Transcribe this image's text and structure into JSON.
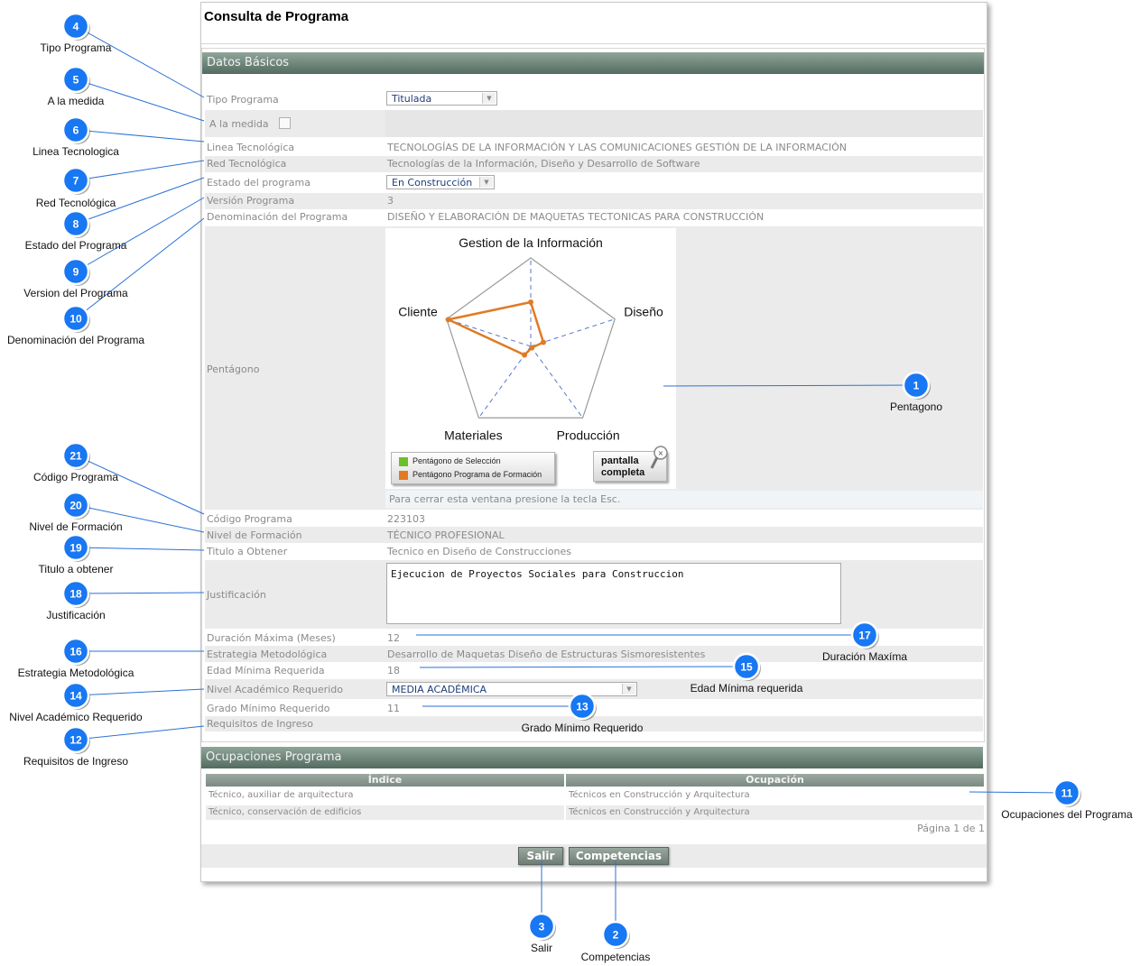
{
  "page_title": "Consulta de Programa",
  "sections": {
    "basic": "Datos Básicos",
    "occupations": "Ocupaciones Programa"
  },
  "fields": {
    "tipo_programa": {
      "label": "Tipo Programa",
      "value": "Titulada"
    },
    "a_la_medida": {
      "label": "A la medida",
      "checked": false
    },
    "linea_tecnologica": {
      "label": "Linea Tecnológica",
      "value": "TECNOLOGÍAS DE LA INFORMACIÓN Y LAS COMUNICACIONES GESTIÓN DE LA INFORMACIÓN"
    },
    "red_tecnologica": {
      "label": "Red Tecnológica",
      "value": "Tecnologías de la Información, Diseño y Desarrollo de Software"
    },
    "estado_programa": {
      "label": "Estado del programa",
      "value": "En Construcción"
    },
    "version_programa": {
      "label": "Versión Programa",
      "value": "3"
    },
    "denominacion": {
      "label": "Denominación del Programa",
      "value": "DISEÑO Y ELABORACIÓN DE MAQUETAS TECTONICAS PARA CONSTRUCCIÓN"
    },
    "pentagono": {
      "label": "Pentágono",
      "note": "Para cerrar esta ventana presione la tecla Esc."
    },
    "codigo_programa": {
      "label": "Código Programa",
      "value": "223103"
    },
    "nivel_formacion": {
      "label": "Nivel de Formación",
      "value": "TÉCNICO PROFESIONAL"
    },
    "titulo_obtener": {
      "label": "Titulo a Obtener",
      "value": "Tecnico en Diseño de Construcciones"
    },
    "justificacion": {
      "label": "Justificación",
      "value": "Ejecucion de Proyectos Sociales para Construccion"
    },
    "duracion_maxima": {
      "label": "Duración Máxima (Meses)",
      "value": "12"
    },
    "estrategia": {
      "label": "Estrategia Metodológica",
      "value": "Desarrollo de Maquetas Diseño de Estructuras Sismoresistentes"
    },
    "edad_minima": {
      "label": "Edad Mínima Requerida",
      "value": "18"
    },
    "nivel_academico": {
      "label": "Nivel Académico Requerido",
      "value": "MEDIA ACADÉMICA"
    },
    "grado_minimo": {
      "label": "Grado Mínimo Requerido",
      "value": "11"
    },
    "requisitos": {
      "label": "Requisitos de Ingreso",
      "value": ""
    }
  },
  "chart_data": {
    "type": "radar",
    "axes": [
      "Gestion de la Información",
      "Diseño",
      "Producción",
      "Materiales",
      "Cliente"
    ],
    "series": [
      {
        "name": "Pentágono de Selección",
        "color": "#6abf2a",
        "values": []
      },
      {
        "name": "Pentágono Programa de Formación",
        "color": "#e07b24",
        "values": [
          0.5,
          0.15,
          0.02,
          0.12,
          0.98
        ]
      }
    ],
    "range": [
      0,
      1
    ]
  },
  "pentagon_ui": {
    "legend_selection": "Pentágono de Selección",
    "legend_program": "Pentágono Programa de Formación",
    "full_screen_line1": "pantalla",
    "full_screen_line2": "completa"
  },
  "occupations_table": {
    "headers": [
      "Índice",
      "Ocupación"
    ],
    "rows": [
      [
        "Técnico, auxiliar de arquitectura",
        "Técnicos en Construcción y Arquitectura"
      ],
      [
        "Técnico, conservación de edificios",
        "Técnicos en Construcción y Arquitectura"
      ]
    ],
    "pagination": "Página 1 de 1"
  },
  "buttons": {
    "salir": "Salir",
    "competencias": "Competencias"
  },
  "annotation_color": "#1877f2",
  "annotations": [
    {
      "num": "4",
      "label": "Tipo Programa"
    },
    {
      "num": "5",
      "label": "A la medida"
    },
    {
      "num": "6",
      "label": "Linea Tecnologica"
    },
    {
      "num": "7",
      "label": "Red Tecnológica"
    },
    {
      "num": "8",
      "label": "Estado del Programa"
    },
    {
      "num": "9",
      "label": "Version del Programa"
    },
    {
      "num": "10",
      "label": "Denominación del Programa"
    },
    {
      "num": "21",
      "label": "Código Programa"
    },
    {
      "num": "20",
      "label": "Nivel de Formación"
    },
    {
      "num": "19",
      "label": "Titulo a obtener"
    },
    {
      "num": "18",
      "label": "Justificación"
    },
    {
      "num": "16",
      "label": "Estrategia Metodológica"
    },
    {
      "num": "14",
      "label": "Nivel Académico Requerido"
    },
    {
      "num": "12",
      "label": "Requisitos de Ingreso"
    },
    {
      "num": "1",
      "label": "Pentagono"
    },
    {
      "num": "17",
      "label": "Duración Maxíma"
    },
    {
      "num": "15",
      "label": "Edad Mínima requerida"
    },
    {
      "num": "13",
      "label": "Grado Mínimo Requerido"
    },
    {
      "num": "11",
      "label": "Ocupaciones del Programa"
    },
    {
      "num": "3",
      "label": "Salir"
    },
    {
      "num": "2",
      "label": "Competencias"
    }
  ]
}
